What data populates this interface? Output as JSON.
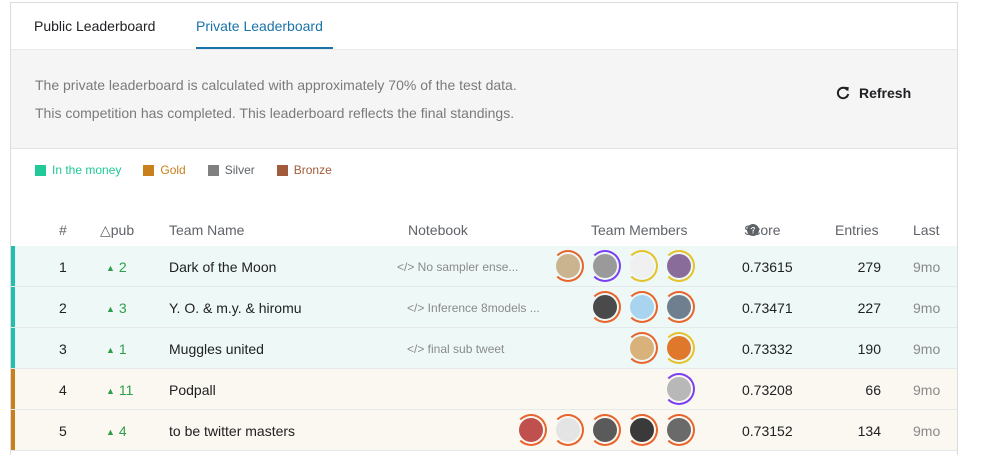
{
  "tabs": [
    {
      "label": "Public Leaderboard",
      "active": false
    },
    {
      "label": "Private Leaderboard",
      "active": true
    }
  ],
  "info": {
    "line1": "The private leaderboard is calculated with approximately 70% of the test data.",
    "line2": "This competition has completed. This leaderboard reflects the final standings.",
    "refresh_label": "Refresh"
  },
  "legend": [
    {
      "label": "In the money",
      "color": "#20beaf",
      "text_color": "#20beaf"
    },
    {
      "label": "Gold",
      "color": "#c9801c",
      "text_color": "#c9801c"
    },
    {
      "label": "Silver",
      "color": "#808080",
      "text_color": "#5f6368"
    },
    {
      "label": "Bronze",
      "color": "#a15b3b",
      "text_color": "#a15b3b"
    }
  ],
  "columns": {
    "rank": "#",
    "delta": "△pub",
    "team": "Team Name",
    "notebook": "Notebook",
    "members": "Team Members",
    "score": "Score",
    "entries": "Entries",
    "last": "Last"
  },
  "rows": [
    {
      "rank": "1",
      "delta": "2",
      "team": "Dark of the Moon",
      "notebook": "</> No sampler ense...",
      "score": "0.73615",
      "entries": "279",
      "last": "9mo",
      "tier": "money",
      "bg": "#eef8f6",
      "bar": "#20beaf",
      "avatars": [
        {
          "ring": "#e8642c",
          "fill": "#c9b48f"
        },
        {
          "ring": "#7b3ff2",
          "fill": "#9a9a9a"
        },
        {
          "ring": "#e5c12a",
          "fill": "#f0f0f0"
        },
        {
          "ring": "#e5c12a",
          "fill": "#8a6c9a"
        }
      ]
    },
    {
      "rank": "2",
      "delta": "3",
      "team": "Y. O. & m.y. & hiromu",
      "notebook": "</> Inference 8models ...",
      "score": "0.73471",
      "entries": "227",
      "last": "9mo",
      "tier": "money",
      "bg": "#eef8f6",
      "bar": "#20beaf",
      "avatars": [
        {
          "ring": "#e8642c",
          "fill": "#4a4a4a"
        },
        {
          "ring": "#e8642c",
          "fill": "#a8d4f0"
        },
        {
          "ring": "#e8642c",
          "fill": "#6f7f8f"
        }
      ]
    },
    {
      "rank": "3",
      "delta": "1",
      "team": "Muggles united",
      "notebook": "</> final sub tweet",
      "score": "0.73332",
      "entries": "190",
      "last": "9mo",
      "tier": "money",
      "bg": "#eef8f6",
      "bar": "#20beaf",
      "avatars": [
        {
          "ring": "#e8642c",
          "fill": "#d8b27a"
        },
        {
          "ring": "#e5c12a",
          "fill": "#e0782c"
        }
      ]
    },
    {
      "rank": "4",
      "delta": "11",
      "team": "Podpall",
      "notebook": "",
      "score": "0.73208",
      "entries": "66",
      "last": "9mo",
      "tier": "gold",
      "bg": "#fbf7f1",
      "bar": "#c9801c",
      "avatars": [
        {
          "ring": "#7b3ff2",
          "fill": "#b8b8b8"
        }
      ]
    },
    {
      "rank": "5",
      "delta": "4",
      "team": "to be twitter masters",
      "notebook": "",
      "score": "0.73152",
      "entries": "134",
      "last": "9mo",
      "tier": "gold",
      "bg": "#fbf7f1",
      "bar": "#c9801c",
      "avatars": [
        {
          "ring": "#e8642c",
          "fill": "#c0504d"
        },
        {
          "ring": "#e8642c",
          "fill": "#e4e4e4"
        },
        {
          "ring": "#e8642c",
          "fill": "#5a5a5a"
        },
        {
          "ring": "#e8642c",
          "fill": "#3a3a3a"
        },
        {
          "ring": "#e8642c",
          "fill": "#6a6a6a"
        }
      ]
    }
  ]
}
